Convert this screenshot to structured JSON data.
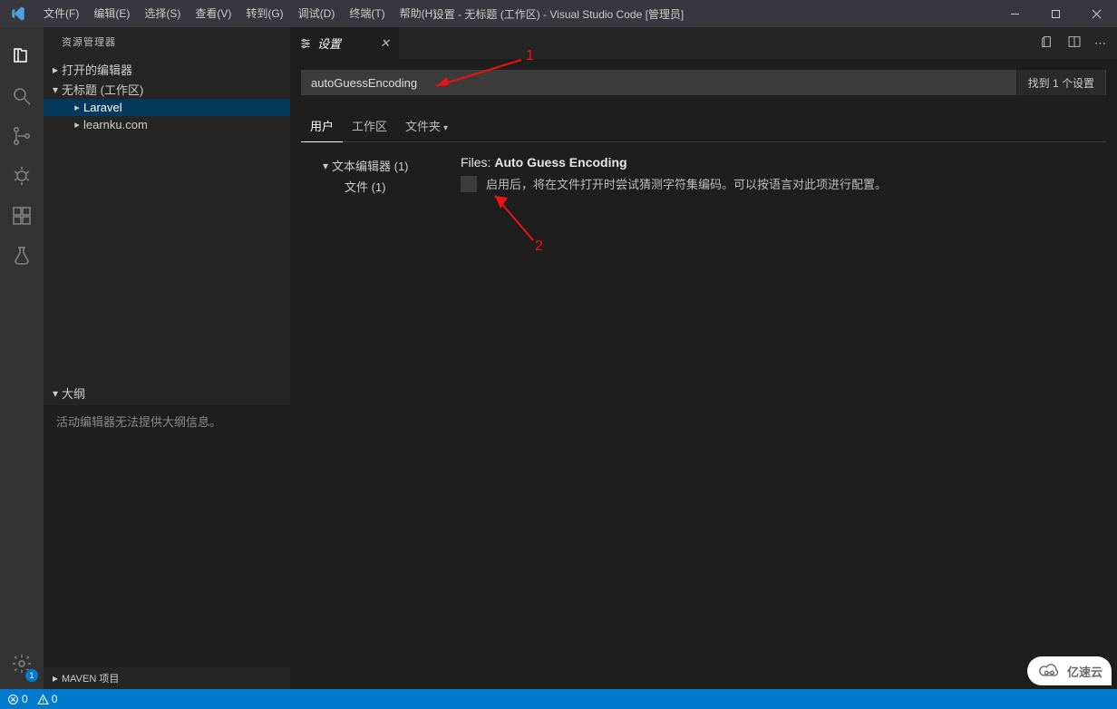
{
  "title_bar": {
    "menus": [
      "文件(F)",
      "编辑(E)",
      "选择(S)",
      "查看(V)",
      "转到(G)",
      "调试(D)",
      "终端(T)",
      "帮助(H)"
    ],
    "window_title": "设置 - 无标题 (工作区) - Visual Studio Code [管理员]"
  },
  "activity": {
    "gear_badge": "1"
  },
  "sidebar": {
    "title": "资源管理器",
    "sections": {
      "open_editors": "打开的编辑器",
      "workspace": "无标题 (工作区)"
    },
    "items": [
      "Laravel",
      "learnku.com"
    ],
    "outline_header": "大纲",
    "outline_empty": "活动编辑器无法提供大纲信息。",
    "maven": "MAVEN 项目"
  },
  "editor": {
    "tab_label": "设置",
    "search_value": "autoGuessEncoding",
    "search_result": "找到 1 个设置",
    "scope_tabs": [
      "用户",
      "工作区",
      "文件夹"
    ],
    "toc": {
      "group": "文本编辑器 (1)",
      "sub": "文件 (1)"
    },
    "setting": {
      "prefix": "Files: ",
      "name": "Auto Guess Encoding",
      "desc": "启用后，将在文件打开时尝试猜测字符集编码。可以按语言对此项进行配置。"
    }
  },
  "status": {
    "errors": "0",
    "warnings": "0"
  },
  "annotations": {
    "a1": "1",
    "a2": "2"
  },
  "watermark": "亿速云"
}
